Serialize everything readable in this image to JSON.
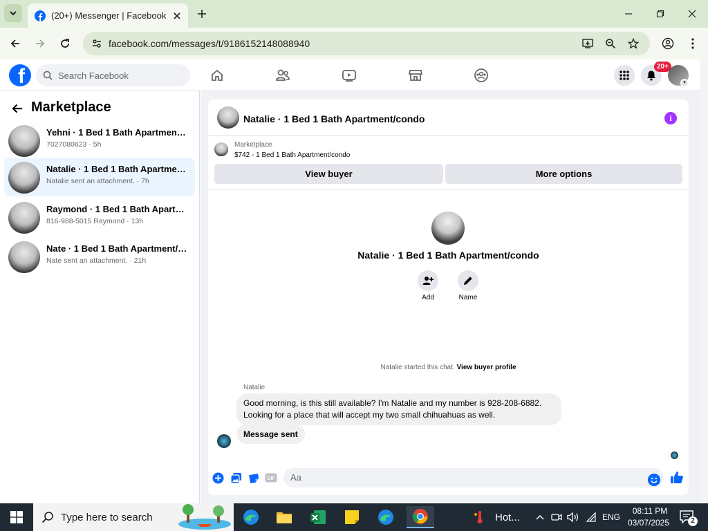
{
  "browser": {
    "tab_title": "(20+) Messenger | Facebook",
    "url": "facebook.com/messages/t/9186152148088940"
  },
  "header": {
    "search_placeholder": "Search Facebook",
    "notification_badge": "20+"
  },
  "sidebar": {
    "title": "Marketplace",
    "conversations": [
      {
        "name": "Yehni · 1 Bed 1 Bath Apartment/co...",
        "sub": "7027080623 · 5h",
        "active": false
      },
      {
        "name": "Natalie · 1 Bed 1 Bath Apartment/c...",
        "sub": "Natalie sent an attachment. · 7h",
        "active": true
      },
      {
        "name": "Raymond · 1 Bed 1 Bath Apartmen...",
        "sub": "816-988-5015 Raymond · 13h",
        "active": false
      },
      {
        "name": "Nate · 1 Bed 1 Bath Apartment/con...",
        "sub": "Nate sent an attachment. · 21h",
        "active": false
      }
    ]
  },
  "chat": {
    "title": "Natalie · 1 Bed 1 Bath Apartment/condo",
    "marketplace_label": "Marketplace",
    "listing": "$742 - 1 Bed 1 Bath Apartment/condo",
    "view_buyer": "View buyer",
    "more_options": "More options",
    "profile_name": "Natalie · 1 Bed 1 Bath Apartment/condo",
    "add_label": "Add",
    "name_label": "Name",
    "started_text": "Natalie started this chat.",
    "view_buyer_profile": "View buyer profile",
    "sender": "Natalie",
    "message_line1": "Good morning, is this still available? I'm Natalie and my number is 928-208-6882.",
    "message_line2": "Looking for a place that will accept my two small chihuahuas as well.",
    "reply": "Message sent",
    "composer_placeholder": "Aa"
  },
  "taskbar": {
    "search_text": "Type here to search",
    "weather": "Hot...",
    "lang": "ENG",
    "time": "08:11 PM",
    "date": "03/07/2025",
    "notif_count": "2"
  },
  "colors": {
    "fb_blue": "#0866ff",
    "active_conv": "#ebf5ff",
    "badge_red": "#e41e3f",
    "info_purple": "#a033ff"
  }
}
